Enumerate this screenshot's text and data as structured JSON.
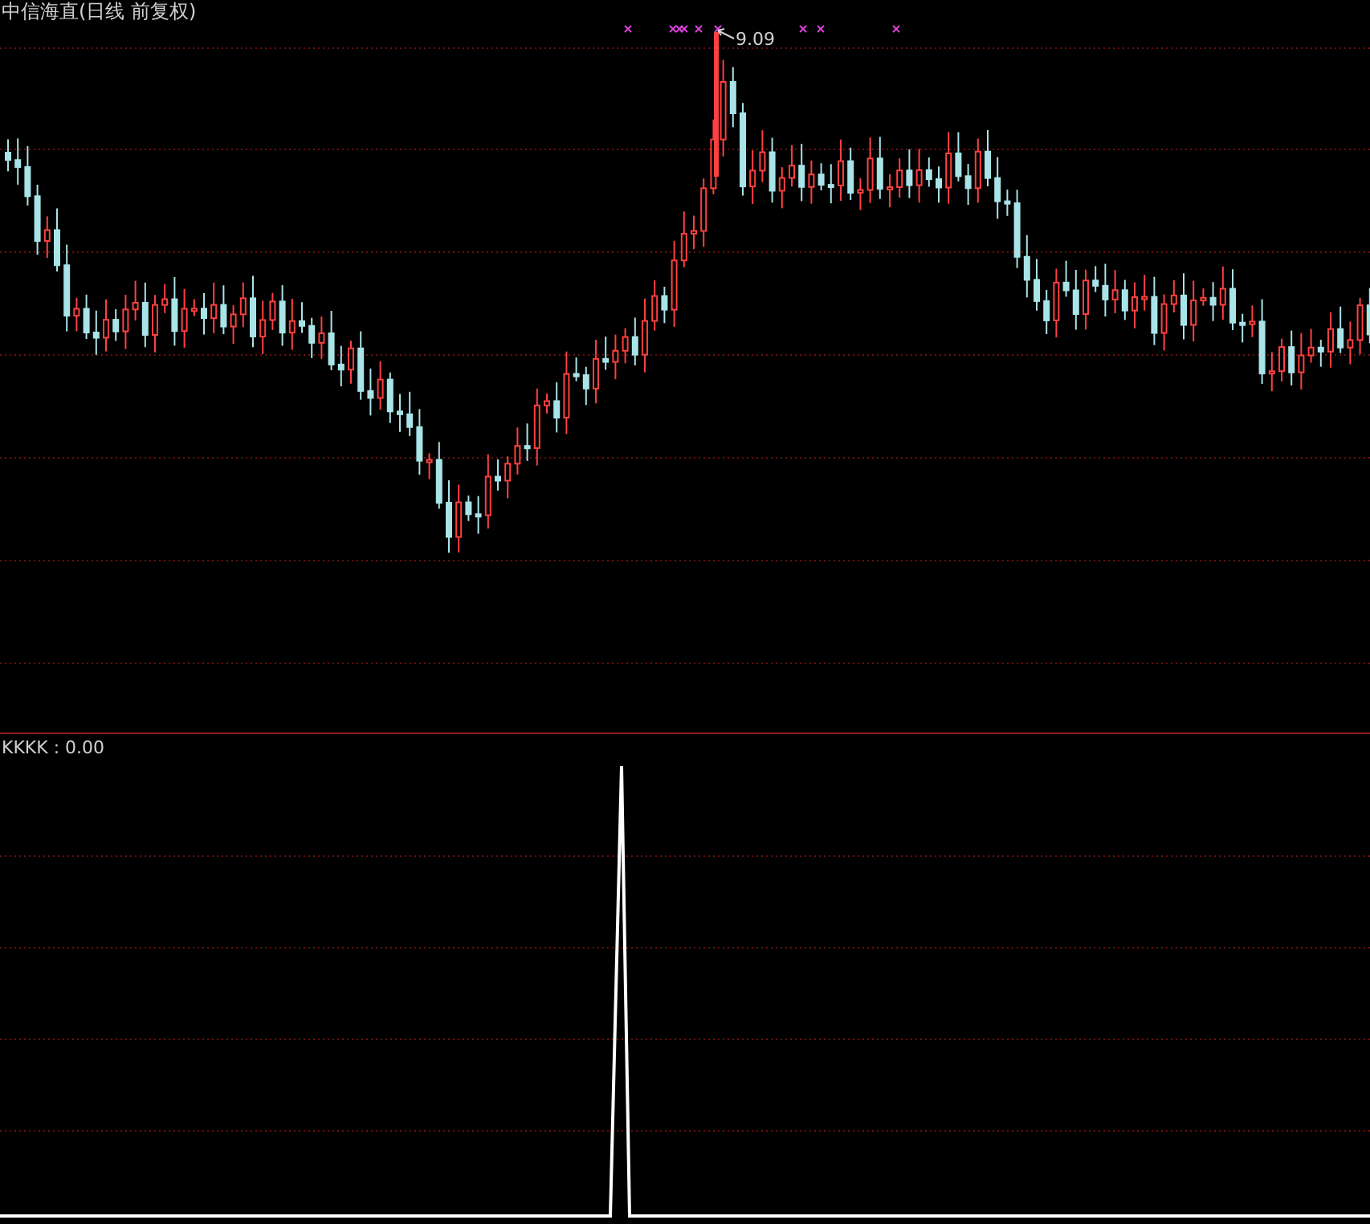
{
  "main_chart": {
    "title": "中信海直(日线 前复权)",
    "high_label": "9.09"
  },
  "indicator": {
    "label": "KKKK : 0.00"
  }
}
